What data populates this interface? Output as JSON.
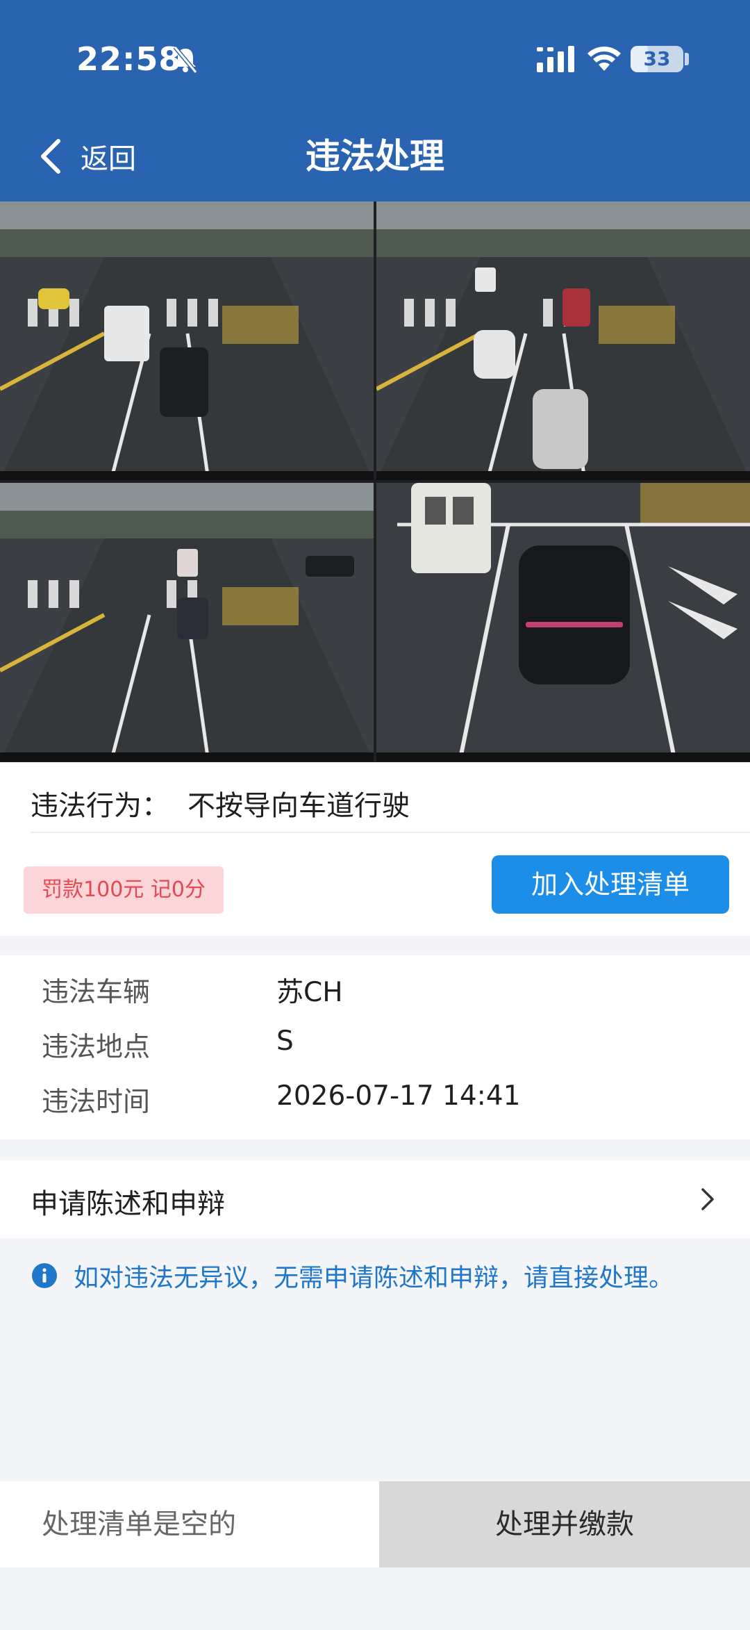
{
  "status_bar": {
    "time": "22:58",
    "battery": "33",
    "battery_level": 0.33
  },
  "header": {
    "back_label": "返回",
    "title": "违法处理"
  },
  "violation": {
    "behavior_label": "违法行为：",
    "behavior_value": "不按导向车道行驶",
    "fine_badge": "罚款100元  记0分",
    "add_button": "加入处理清单"
  },
  "details": [
    {
      "label": "违法车辆",
      "value": "苏CH"
    },
    {
      "label": "违法地点",
      "value": "S"
    },
    {
      "label": "违法时间",
      "value": "2026-07-17 14:41"
    }
  ],
  "appeal": {
    "label": "申请陈述和申辩"
  },
  "notice": {
    "text": "如对违法无异议，无需申请陈述和申辩，请直接处理。"
  },
  "bottom_bar": {
    "list_status": "处理清单是空的",
    "pay_button": "处理并缴款"
  },
  "colors": {
    "header_bg": "#2a64b0",
    "primary_button": "#1c8ee8",
    "fine_badge_bg": "#fcd5d8",
    "fine_badge_text": "#e24a55",
    "notice_text": "#2077c9"
  },
  "icons": {
    "back": "chevron-left-icon",
    "mute": "bell-slash-icon",
    "signal": "signal-icon",
    "wifi": "wifi-icon",
    "battery": "battery-icon",
    "appeal": "chevron-right-icon",
    "notice": "info-circle-icon"
  }
}
